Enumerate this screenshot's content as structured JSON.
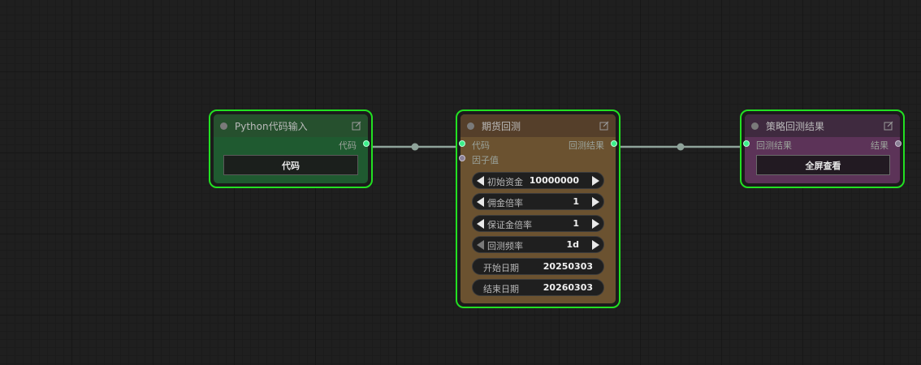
{
  "nodes": {
    "python": {
      "title": "Python代码输入",
      "output_label": "代码",
      "button_label": "代码"
    },
    "futures": {
      "title": "期货回测",
      "input_code_label": "代码",
      "input_factor_label": "因子值",
      "output_label": "回测结果",
      "widgets": [
        {
          "label": "初始资金",
          "value": "10000000"
        },
        {
          "label": "佣金倍率",
          "value": "1"
        },
        {
          "label": "保证金倍率",
          "value": "1"
        },
        {
          "label": "回测频率",
          "value": "1d"
        },
        {
          "label": "开始日期",
          "value": "20250303"
        },
        {
          "label": "结束日期",
          "value": "20260303"
        }
      ]
    },
    "result": {
      "title": "策略回测结果",
      "input_label": "回测结果",
      "output_label": "结果",
      "button_label": "全屏查看"
    }
  },
  "colors": {
    "selection_border": "#22e022",
    "python_body": "#1f5a30",
    "futures_body": "#6b5230",
    "result_body": "#5c3358",
    "wire": "#8fa39a"
  },
  "icons": [
    "edit-icon",
    "arrow-left-icon",
    "arrow-right-icon"
  ]
}
